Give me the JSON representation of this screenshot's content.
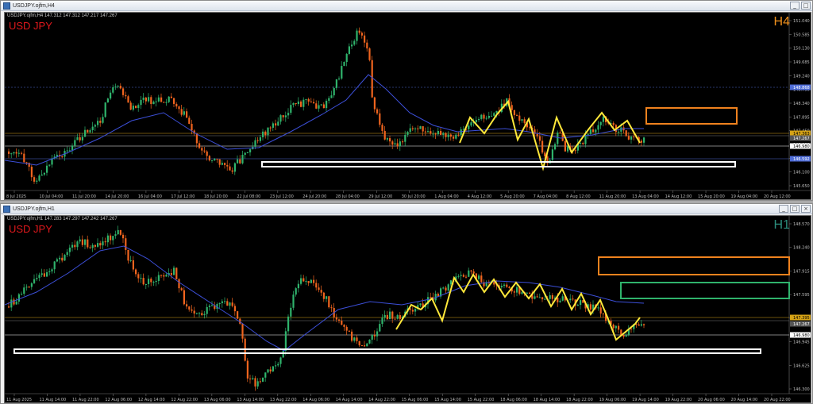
{
  "windows": [
    {
      "title": "USDJPY.ojfm,H4",
      "ohlc": "USDJPY.ojfm,H4  147.312 147.312 147.217 147.267",
      "symbol": "USD JPY",
      "timeframe": "H4",
      "tf_color": "#f0901c",
      "controls": [
        "_",
        "□"
      ],
      "price_axis": [
        "151.040",
        "150.585",
        "150.130",
        "149.685",
        "149.240",
        "148.790",
        "148.340",
        "147.895",
        "147.450",
        "146.980",
        "146.555",
        "146.100",
        "145.650"
      ],
      "price_badges": [
        {
          "text": "148.868",
          "bg": "#4f6dd8",
          "fg": "#ffffff"
        },
        {
          "text": "147.363",
          "bg": "#d6a316",
          "fg": "#000000"
        },
        {
          "text": "147.267",
          "bg": "#555555",
          "fg": "#ffffff"
        },
        {
          "text": "146.980",
          "bg": "#ffffff",
          "fg": "#000000"
        },
        {
          "text": "146.592",
          "bg": "#4f6dd8",
          "fg": "#ffffff"
        }
      ],
      "time_axis": [
        "8 Jul 2025",
        "10 Jul 04:00",
        "11 Jul 20:00",
        "14 Jul 20:00",
        "16 Jul 04:00",
        "17 Jul 12:00",
        "18 Jul 20:00",
        "22 Jul 08:00",
        "23 Jul 12:00",
        "24 Jul 20:00",
        "28 Jul 04:00",
        "29 Jul 12:00",
        "30 Jul 20:00",
        "1 Aug 04:00",
        "4 Aug 12:00",
        "5 Aug 20:00",
        "7 Aug 04:00",
        "8 Aug 12:00",
        "11 Aug 20:00",
        "13 Aug 04:00",
        "14 Aug 12:00",
        "15 Aug 20:00",
        "19 Aug 04:00",
        "20 Aug 12:00"
      ],
      "colors": {
        "bull": "#2fb36c",
        "bear": "#f0641e",
        "ma": "#3c4fd8",
        "zigzag": "#ffe83a",
        "orange_box": "#f0821e",
        "white_box": "#ffffff"
      }
    },
    {
      "title": "USDJPY.ojfm,H1",
      "ohlc": "USDJPY.ojfm,H1  147.283 147.297 147.242 147.267",
      "symbol": "USD JPY",
      "timeframe": "H1",
      "tf_color": "#2c8f7e",
      "controls": [
        "_",
        "□",
        "×"
      ],
      "price_axis": [
        "148.570",
        "148.240",
        "147.915",
        "147.595",
        "147.270",
        "146.945",
        "146.625",
        "146.300"
      ],
      "price_badges": [
        {
          "text": "147.395",
          "bg": "#d6a316",
          "fg": "#000000"
        },
        {
          "text": "147.267",
          "bg": "#555555",
          "fg": "#ffffff"
        },
        {
          "text": "146.980",
          "bg": "#ffffff",
          "fg": "#000000"
        }
      ],
      "time_axis": [
        "11 Aug 2025",
        "11 Aug 14:00",
        "11 Aug 22:00",
        "12 Aug 06:00",
        "12 Aug 14:00",
        "12 Aug 22:00",
        "13 Aug 06:00",
        "13 Aug 14:00",
        "13 Aug 22:00",
        "14 Aug 06:00",
        "14 Aug 14:00",
        "14 Aug 22:00",
        "15 Aug 06:00",
        "15 Aug 14:00",
        "15 Aug 22:00",
        "18 Aug 06:00",
        "18 Aug 14:00",
        "18 Aug 22:00",
        "19 Aug 06:00",
        "19 Aug 14:00",
        "19 Aug 22:00",
        "20 Aug 06:00",
        "20 Aug 14:00",
        "20 Aug 22:00"
      ],
      "colors": {
        "bull": "#2fb36c",
        "bear": "#f0641e",
        "ma": "#3c4fd8",
        "zigzag": "#ffe83a",
        "orange_box": "#f0821e",
        "green_box": "#2fb36c",
        "white_box": "#ffffff"
      }
    }
  ]
}
